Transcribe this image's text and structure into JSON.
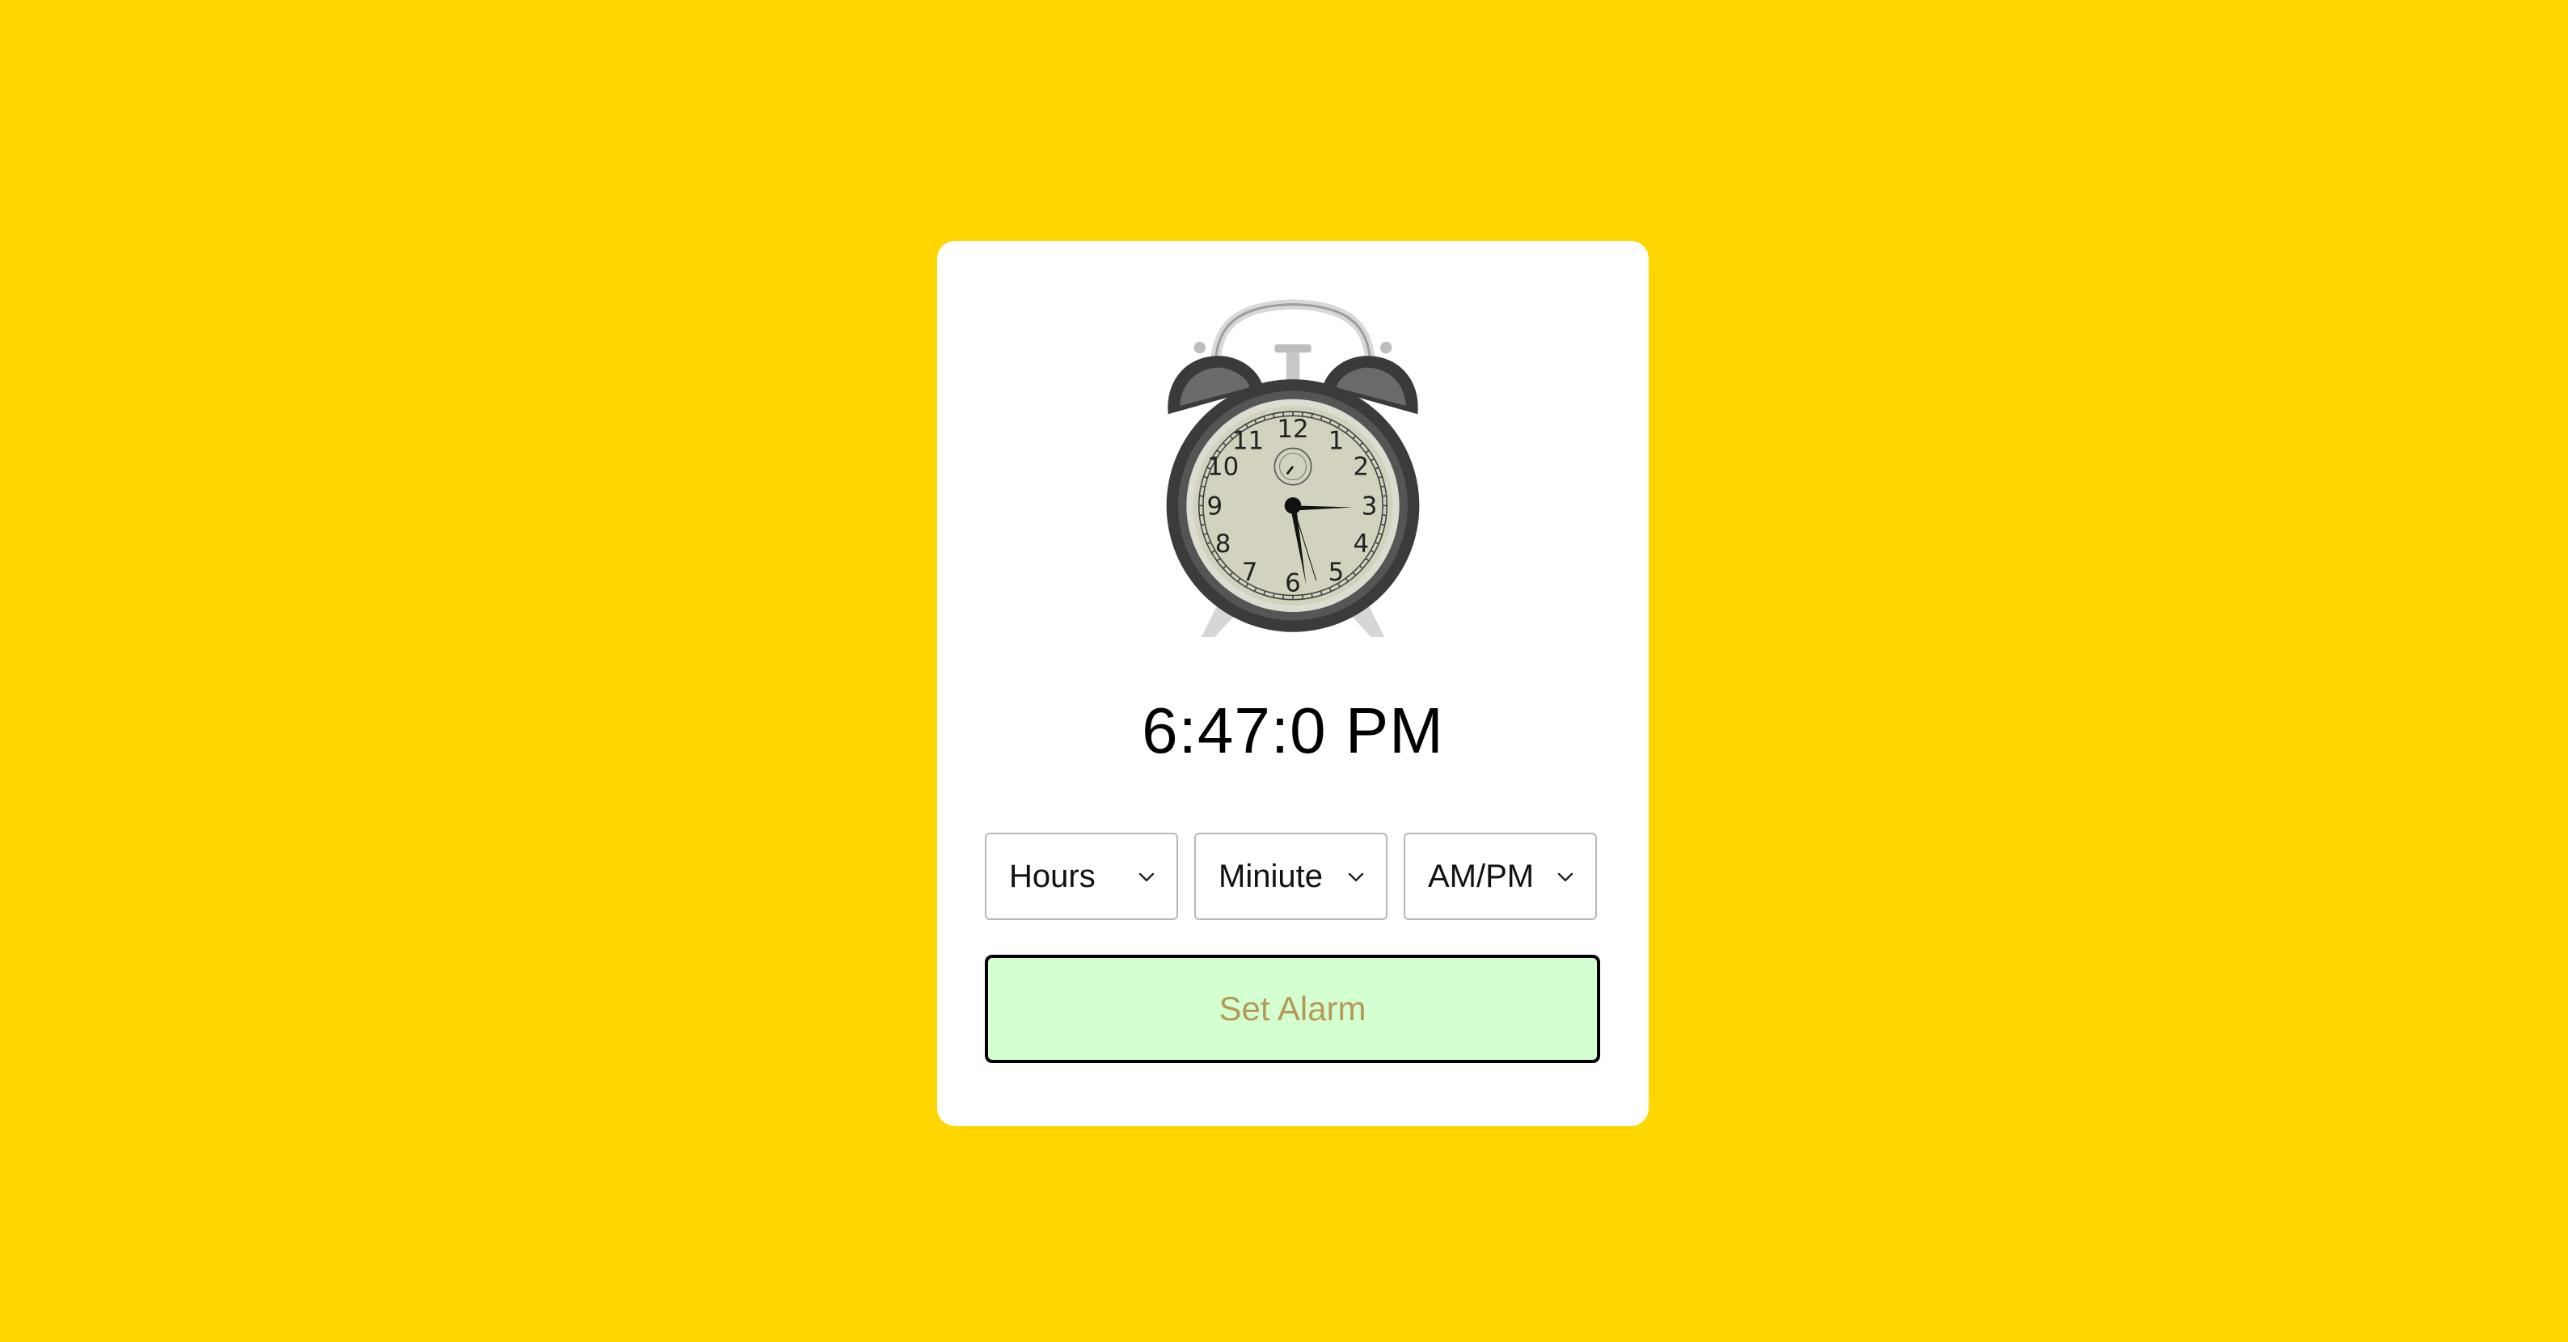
{
  "clock": {
    "current_time": "6:47:0 PM",
    "icon": "alarm-clock-icon"
  },
  "selects": {
    "hours": {
      "value": "Hours"
    },
    "minute": {
      "value": "Miniute"
    },
    "ampm": {
      "value": "AM/PM"
    }
  },
  "actions": {
    "set_alarm_label": "Set Alarm"
  },
  "colors": {
    "background": "#FFD600",
    "card": "#FFFFFF",
    "button_bg": "#D4FFD0",
    "button_text": "#B59A55",
    "button_border": "#000000"
  }
}
